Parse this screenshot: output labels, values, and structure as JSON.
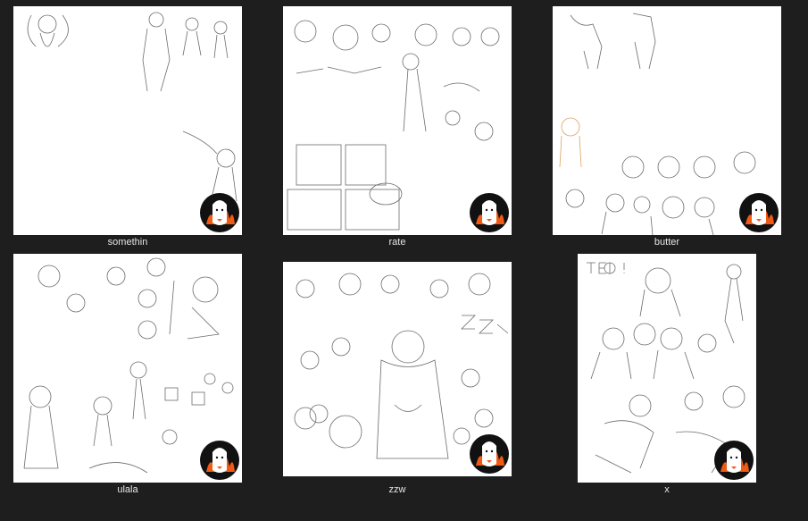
{
  "files": [
    {
      "name": "somethin"
    },
    {
      "name": "rate"
    },
    {
      "name": "butter"
    },
    {
      "name": "ulala"
    },
    {
      "name": "zzw"
    },
    {
      "name": "x"
    }
  ],
  "colors": {
    "background": "#1e1e1e",
    "thumb": "#ffffff",
    "sketch_line": "#6b6b6b",
    "badge_black": "#111111",
    "badge_orange": "#f05a14",
    "caption": "#e6e6e6"
  },
  "badge_icon": "alpaca-flame-logo-icon"
}
